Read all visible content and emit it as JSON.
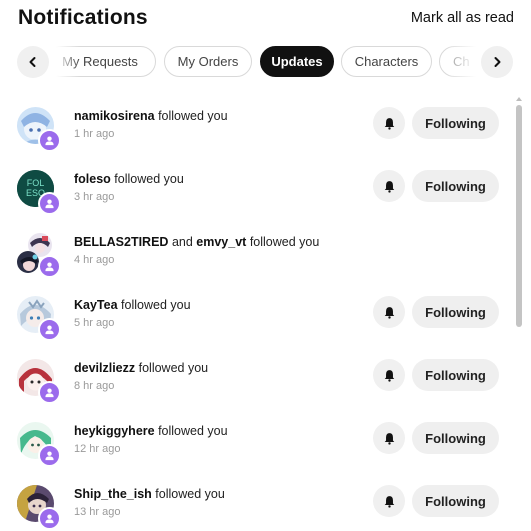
{
  "header": {
    "title": "Notifications",
    "mark_all": "Mark all as read"
  },
  "tabs": [
    {
      "label": "My Requests",
      "active": false
    },
    {
      "label": "My Orders",
      "active": false
    },
    {
      "label": "Updates",
      "active": true
    },
    {
      "label": "Characters",
      "active": false
    },
    {
      "label": "Ch",
      "active": false
    }
  ],
  "notifications": [
    {
      "user": "namikosirena",
      "action": "followed you",
      "time": "1 hr ago",
      "button": "Following"
    },
    {
      "user": "foleso",
      "action": "followed you",
      "time": "3 hr ago",
      "button": "Following",
      "avatar_text": "FOL\nESO"
    },
    {
      "user": "BELLAS2TIRED",
      "joiner": "and",
      "user2": "emvy_vt",
      "action": "followed you",
      "time": "4 hr ago"
    },
    {
      "user": "KayTea",
      "action": "followed you",
      "time": "5 hr ago",
      "button": "Following"
    },
    {
      "user": "devilzliezz",
      "action": "followed you",
      "time": "8 hr ago",
      "button": "Following"
    },
    {
      "user": "heykiggyhere",
      "action": "followed you",
      "time": "12 hr ago",
      "button": "Following"
    },
    {
      "user": "Ship_the_ish",
      "action": "followed you",
      "time": "13 hr ago",
      "button": "Following"
    }
  ],
  "icons": {
    "tabs_prev": "chevron-left-icon",
    "tabs_next": "chevron-right-icon",
    "badge": "person-icon",
    "bell": "bell-icon"
  },
  "colors": {
    "badge": "#9b6bec",
    "active_tab": "#111111",
    "button_bg": "#efefef"
  }
}
